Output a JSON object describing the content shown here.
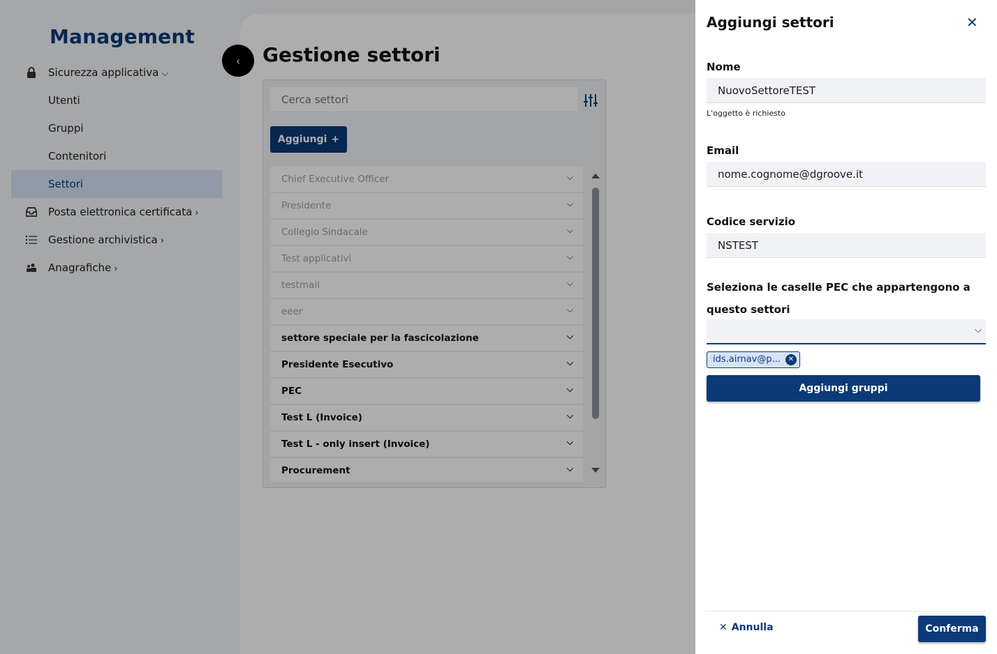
{
  "sidebar": {
    "brand": "Management",
    "items": [
      {
        "label": "Sicurezza applicativa",
        "icon": "lock-icon",
        "expandable": true,
        "expanded": true
      },
      {
        "label": "Utenti"
      },
      {
        "label": "Gruppi"
      },
      {
        "label": "Contenitori"
      },
      {
        "label": "Settori",
        "active": true
      },
      {
        "label": "Posta elettronica certificata",
        "icon": "inbox-icon",
        "expandable": true
      },
      {
        "label": "Gestione archivistica",
        "icon": "list-icon",
        "expandable": true
      },
      {
        "label": "Anagrafiche",
        "icon": "people-icon",
        "expandable": true
      }
    ]
  },
  "main": {
    "title": "Gestione settori",
    "search_placeholder": "Cerca settori",
    "add_label": "Aggiungi",
    "rows": [
      {
        "label": "Chief Executive Officer",
        "style": "muted"
      },
      {
        "label": "Presidente",
        "style": "muted"
      },
      {
        "label": "Collegio Sindacale",
        "style": "muted"
      },
      {
        "label": "Test applicativi",
        "style": "muted"
      },
      {
        "label": "testmail",
        "style": "muted"
      },
      {
        "label": "eeer",
        "style": "muted"
      },
      {
        "label": "settore speciale per la fascicolazione",
        "style": "strong"
      },
      {
        "label": "Presidente Esecutivo",
        "style": "strong"
      },
      {
        "label": "PEC",
        "style": "strong"
      },
      {
        "label": "Test L (Invoice)",
        "style": "strong"
      },
      {
        "label": "Test L - only insert (Invoice)",
        "style": "strong"
      },
      {
        "label": "Procurement",
        "style": "strong"
      }
    ]
  },
  "drawer": {
    "title": "Aggiungi settori",
    "name_label": "Nome",
    "name_value": "NuovoSettoreTEST",
    "name_hint": "L'oggetto è richiesto",
    "email_label": "Email",
    "email_value": "nome.cognome@dgroove.it",
    "code_label": "Codice servizio",
    "code_value": "NSTEST",
    "pec_label": "Seleziona le caselle PEC che appartengono a questo settori",
    "pec_select_value": "",
    "pec_chip": "ids.airnav@p...",
    "add_groups_label": "Aggiungi gruppi",
    "cancel_label": "Annulla",
    "confirm_label": "Conferma"
  },
  "colors": {
    "primary": "#0b3a78",
    "active_bg": "#d6e2f5",
    "overlay": "rgba(0,0,0,0.32)"
  }
}
